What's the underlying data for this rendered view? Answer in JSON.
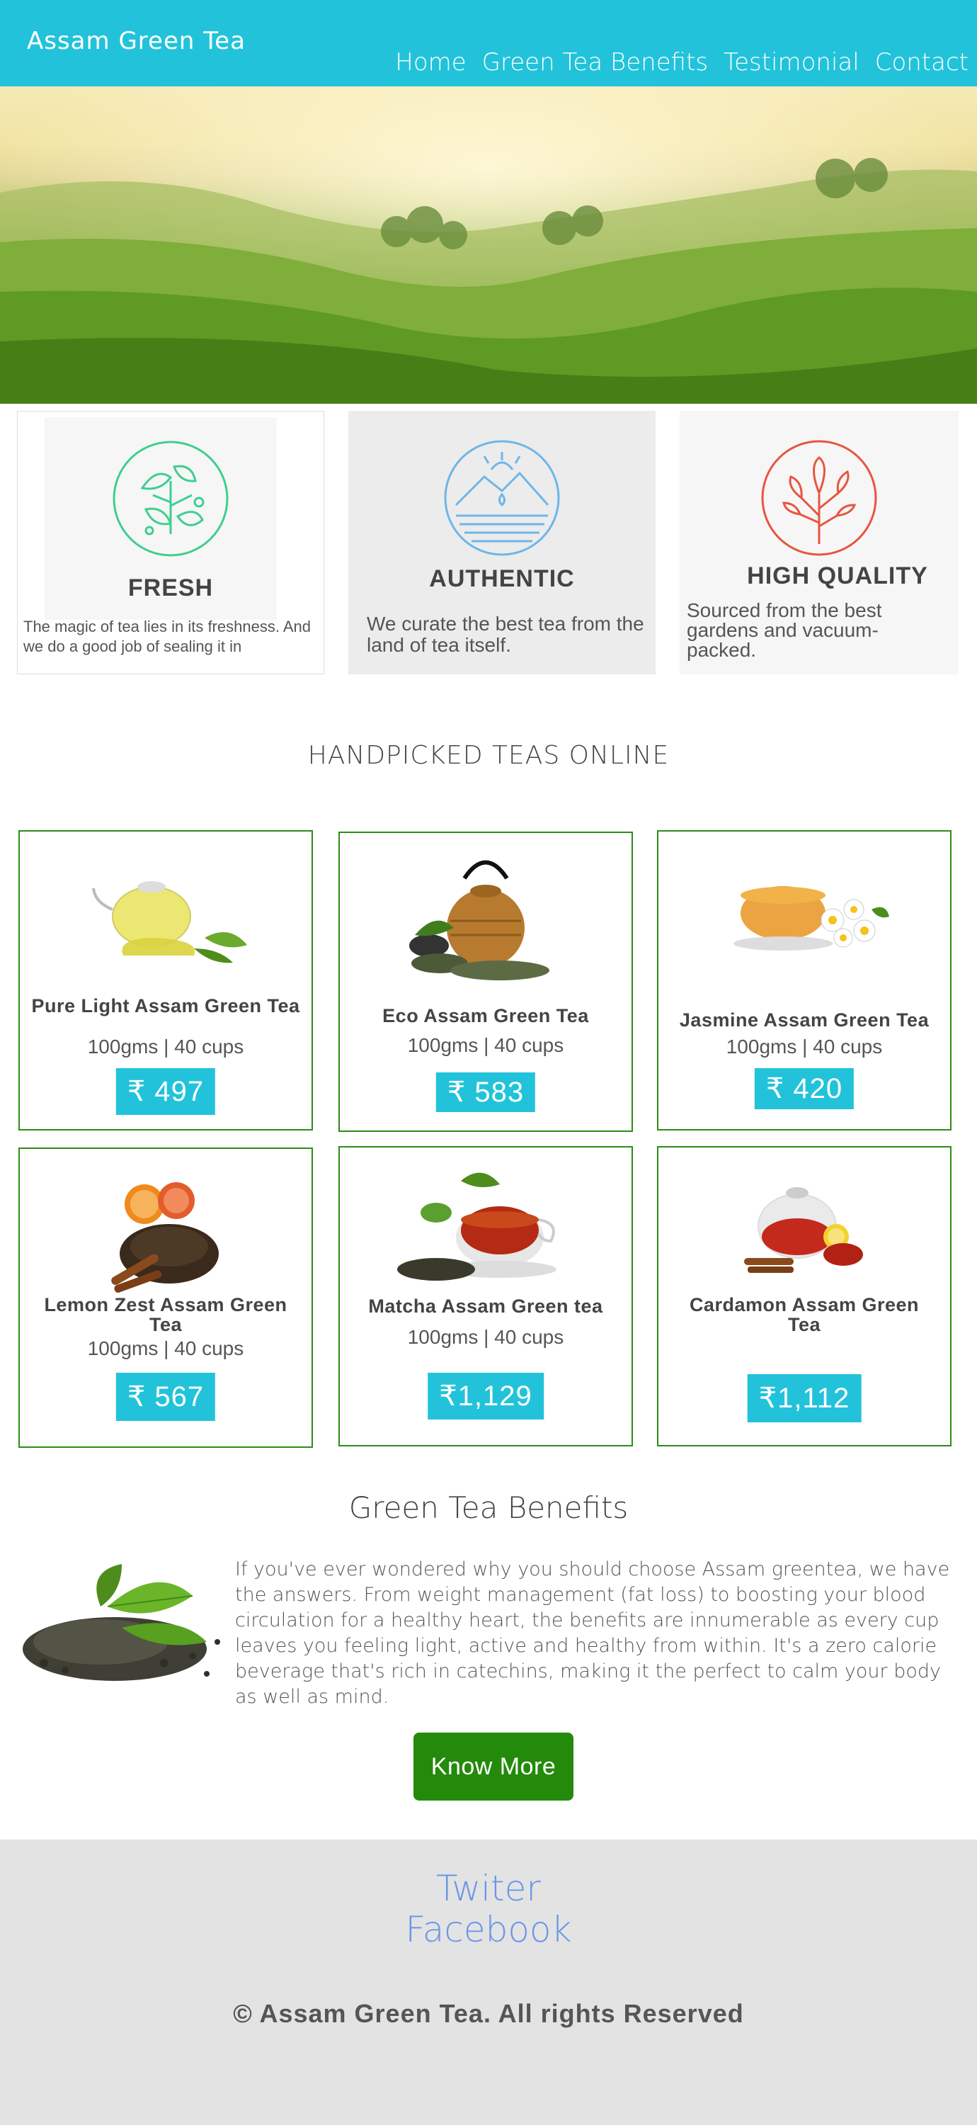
{
  "header": {
    "brand": "Assam Green Tea",
    "nav": [
      "Home",
      "Green Tea Benefits",
      "Testimonial",
      "Contact"
    ]
  },
  "features": [
    {
      "title": "FRESH",
      "text": "The magic of tea lies in its freshness. And we do a good job of sealing it in",
      "icon": "leaf-circle-icon",
      "color": "#3ecf8e"
    },
    {
      "title": "AUTHENTIC",
      "text": "We curate the best tea from the land of tea itself.",
      "icon": "mountain-sun-icon",
      "color": "#6eb6e8"
    },
    {
      "title": "HIGH QUALITY",
      "text": "Sourced from the best gardens and vacuum-packed.",
      "icon": "tree-icon",
      "color": "#e8553e"
    }
  ],
  "products_section": {
    "title": "HANDPICKED TEAS ONLINE"
  },
  "products": [
    {
      "name": "Pure Light Assam Green Tea",
      "desc": "100gms | 40 cups",
      "price": "₹ 497"
    },
    {
      "name": "Eco Assam Green Tea",
      "desc": "100gms | 40 cups",
      "price": "₹ 583"
    },
    {
      "name": "Jasmine Assam Green Tea",
      "desc": "100gms | 40 cups",
      "price": "₹ 420"
    },
    {
      "name": "Lemon Zest Assam Green Tea",
      "desc": "100gms | 40 cups",
      "price": "₹ 567"
    },
    {
      "name": "Matcha Assam Green tea",
      "desc": "100gms | 40 cups",
      "price": "₹1,129"
    },
    {
      "name": "Cardamon Assam Green Tea",
      "desc": "",
      "price": "₹1,112"
    }
  ],
  "benefits": {
    "title": "Green Tea Benefits",
    "text": "If you've ever wondered why you should choose Assam greentea, we have the answers. From weight management (fat loss) to boosting your blood circulation for a healthy heart, the benefits are innumerable as every cup leaves you feeling light, active and healthy from within. It's a zero calorie beverage that's rich in catechins, making it the perfect to calm your body as well as mind.",
    "button": "Know More"
  },
  "footer": {
    "links": [
      "Twiter",
      "Facebook"
    ],
    "copyright": "© Assam Green Tea. All rights Reserved"
  },
  "colors": {
    "accent": "#22c3da",
    "button": "#238a0b",
    "card_border": "#2e8b1a",
    "link": "#6b96e8",
    "footer_bg": "#e3e3e3"
  }
}
